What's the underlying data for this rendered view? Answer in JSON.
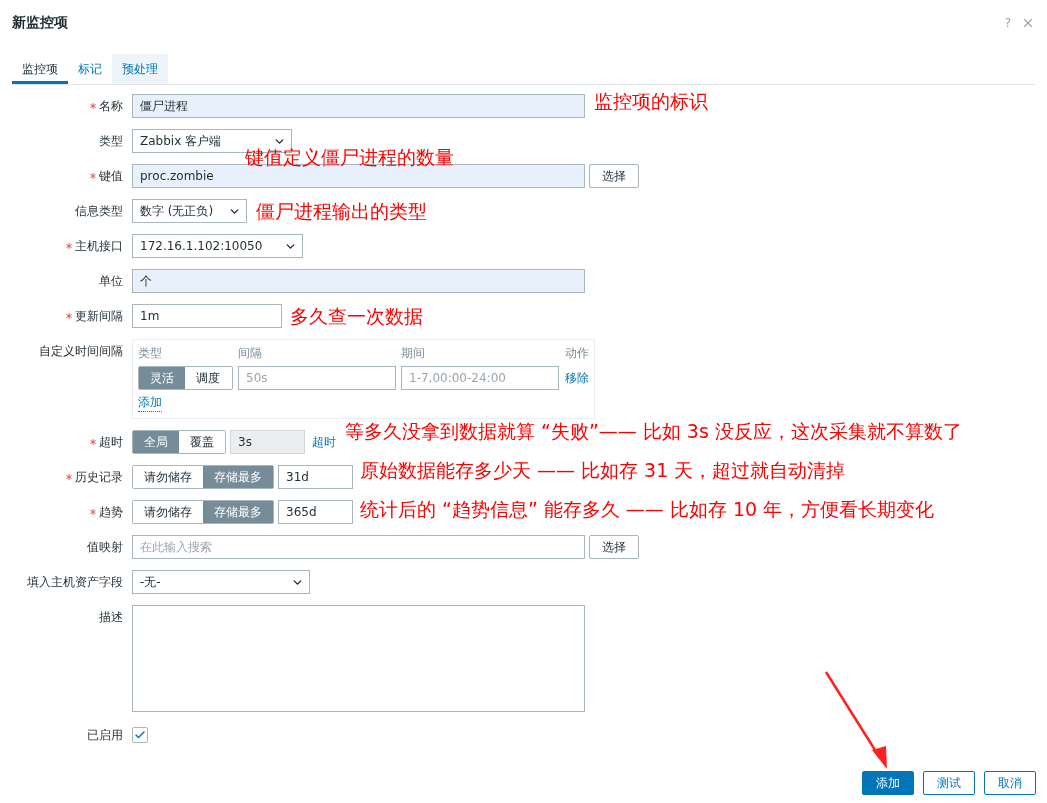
{
  "dialog": {
    "title": "新监控项",
    "help": "?"
  },
  "tabs": [
    {
      "label": "监控项",
      "selected": true,
      "hovered": false
    },
    {
      "label": "标记",
      "selected": false,
      "hovered": false
    },
    {
      "label": "预处理",
      "selected": false,
      "hovered": true
    }
  ],
  "fields": [
    {
      "kind": "text",
      "label": "名称",
      "required": true,
      "value": "僵尸进程",
      "autofilled": true
    },
    {
      "kind": "select",
      "label": "类型",
      "required": false,
      "value": "Zabbix 客户端"
    },
    {
      "kind": "text",
      "label": "键值",
      "required": true,
      "value": "proc.zombie",
      "autofilled": true,
      "button": "选择"
    },
    {
      "kind": "select",
      "label": "信息类型",
      "required": false,
      "value": "数字 (无正负)"
    },
    {
      "kind": "select",
      "label": "主机接口",
      "required": true,
      "value": "172.16.1.102:10050"
    },
    {
      "kind": "text",
      "label": "单位",
      "required": false,
      "value": "个",
      "autofilled": true
    },
    {
      "kind": "text",
      "label": "更新间隔",
      "required": true,
      "value": "1m",
      "autofilled": false
    },
    {
      "kind": "intervals",
      "label": "自定义时间间隔",
      "required": false,
      "columns": [
        "类型",
        "间隔",
        "期间",
        "动作"
      ],
      "rows": [
        {
          "options": [
            {
              "label": "灵活",
              "selected": true
            },
            {
              "label": "调度",
              "selected": false
            }
          ],
          "interval_placeholder": "50s",
          "period_placeholder": "1-7,00:00-24:00",
          "remove": "移除"
        }
      ],
      "add": "添加"
    },
    {
      "kind": "override",
      "label": "超时",
      "required": true,
      "options": [
        {
          "label": "全局",
          "selected": true
        },
        {
          "label": "覆盖",
          "selected": false
        }
      ],
      "value": "3s",
      "disabled": true,
      "link": "超时"
    },
    {
      "kind": "override",
      "label": "历史记录",
      "required": true,
      "options": [
        {
          "label": "请勿储存",
          "selected": false
        },
        {
          "label": "存储最多",
          "selected": true
        }
      ],
      "value": "31d",
      "disabled": false
    },
    {
      "kind": "override",
      "label": "趋势",
      "required": true,
      "options": [
        {
          "label": "请勿储存",
          "selected": false
        },
        {
          "label": "存储最多",
          "selected": true
        }
      ],
      "value": "365d",
      "disabled": false
    },
    {
      "kind": "text",
      "label": "值映射",
      "required": false,
      "placeholder": "在此输入搜索",
      "autofilled": false,
      "button": "选择"
    },
    {
      "kind": "select",
      "label": "填入主机资产字段",
      "required": false,
      "value": "-无-"
    },
    {
      "kind": "textarea",
      "label": "描述",
      "required": false
    },
    {
      "kind": "checkbox",
      "label": "已启用",
      "required": false,
      "checked": true
    }
  ],
  "annotations": [
    "监控项的标识",
    "键值定义僵尸进程的数量",
    "僵尸进程输出的类型",
    "多久查一次数据",
    "等多久没拿到数据就算 “失败”—— 比如 3s 没反应，这次采集就不算数了",
    "原始数据能存多少天 —— 比如存 31 天，超过就自动清掉",
    "统计后的 “趋势信息” 能存多久 —— 比如存 10 年，方便看长期变化"
  ],
  "buttons": [
    {
      "label": "添加",
      "primary": true
    },
    {
      "label": "测试",
      "primary": false
    },
    {
      "label": "取消",
      "primary": false
    }
  ]
}
